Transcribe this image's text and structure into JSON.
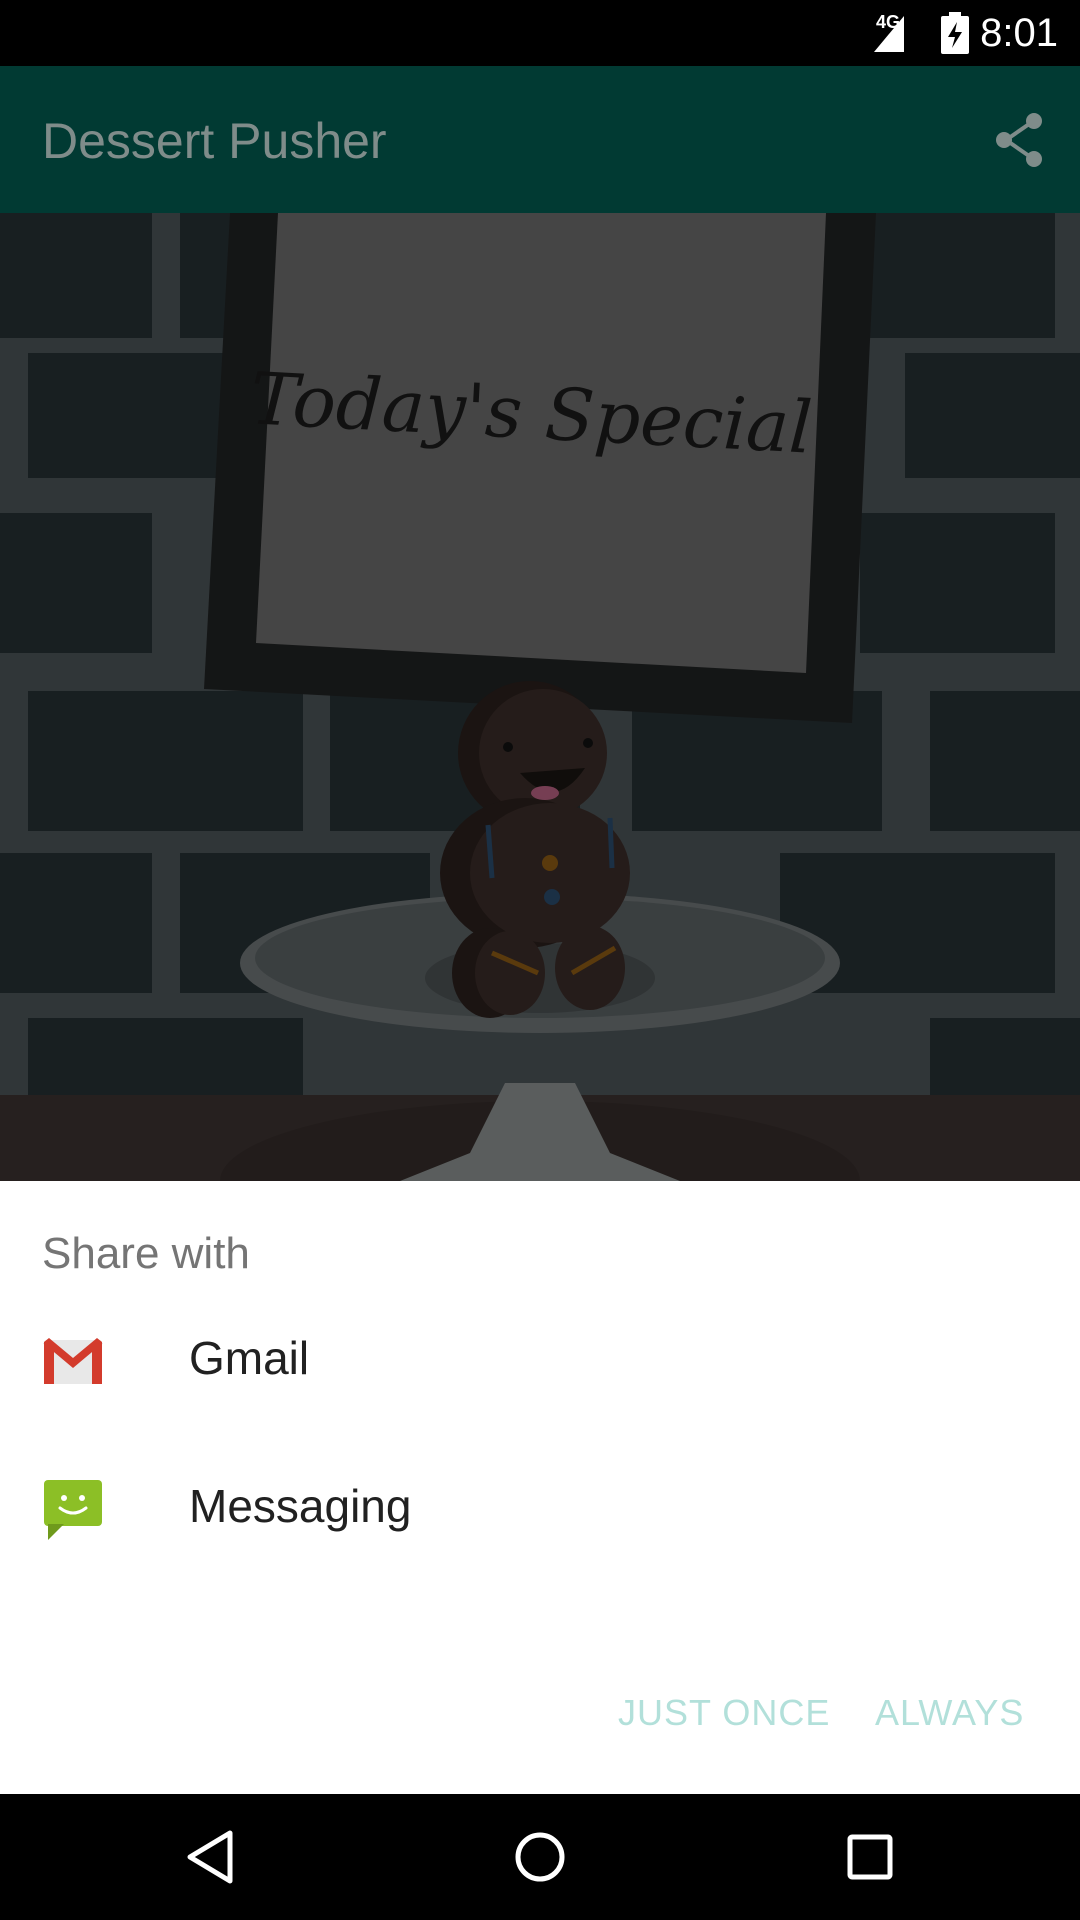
{
  "status_bar": {
    "network": "4G",
    "time": "8:01",
    "icons": [
      "signal-icon",
      "battery-charging-icon"
    ]
  },
  "app_bar": {
    "title": "Dessert Pusher",
    "action_icon": "share-icon"
  },
  "hero": {
    "sign_text": "Today's Special"
  },
  "share_sheet": {
    "title": "Share with",
    "items": [
      {
        "label": "Gmail",
        "icon": "gmail-icon"
      },
      {
        "label": "Messaging",
        "icon": "messaging-icon"
      }
    ],
    "buttons": {
      "just_once": "JUST ONCE",
      "always": "ALWAYS"
    }
  },
  "nav_bar": {
    "icons": [
      "back-icon",
      "home-icon",
      "recents-icon"
    ]
  },
  "colors": {
    "app_bar": "#013a33",
    "button_text": "#b2e0da"
  }
}
